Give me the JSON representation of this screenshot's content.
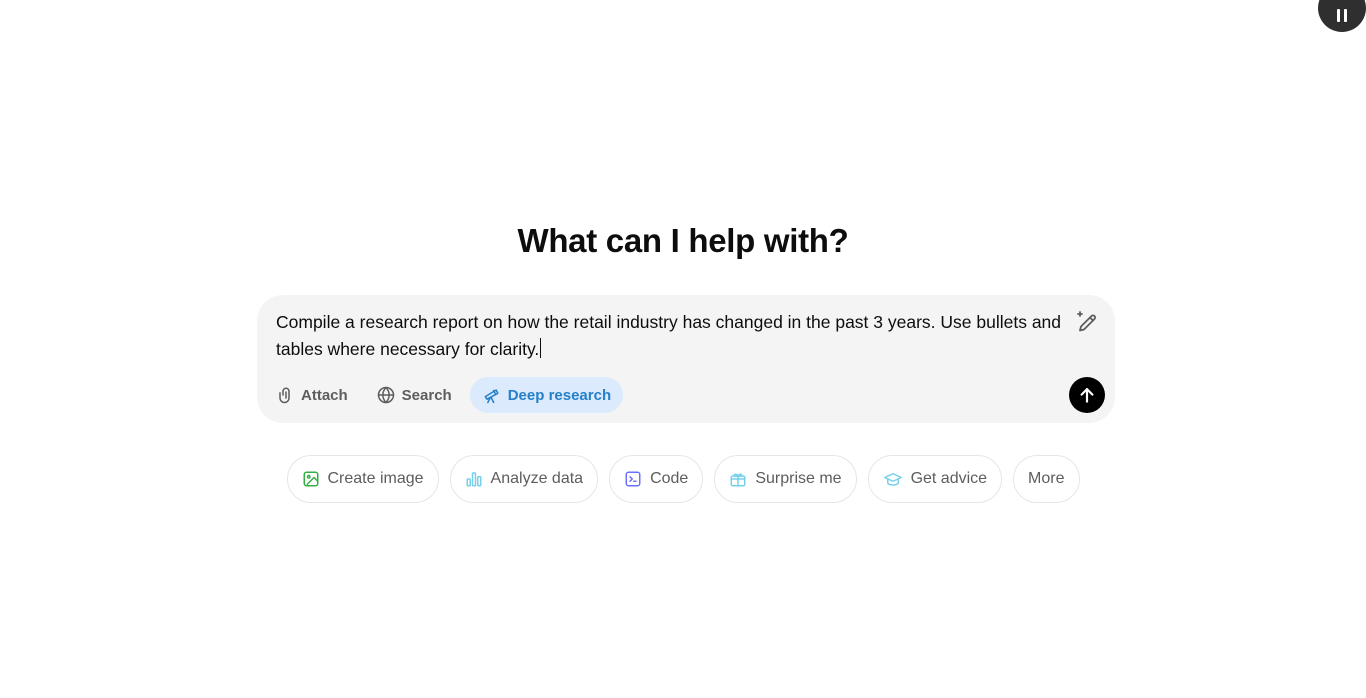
{
  "heading": "What can I help with?",
  "composer": {
    "prompt": "Compile a research report on how the retail industry has changed in the past 3 years. Use bullets and tables where necessary for clarity."
  },
  "tools": [
    {
      "label": "Attach",
      "icon": "paperclip-icon",
      "active": false
    },
    {
      "label": "Search",
      "icon": "globe-icon",
      "active": false
    },
    {
      "label": "Deep research",
      "icon": "telescope-icon",
      "active": true
    }
  ],
  "suggestions": [
    {
      "label": "Create image",
      "icon": "image-icon",
      "color": "#35ae47"
    },
    {
      "label": "Analyze data",
      "icon": "bar-chart-icon",
      "color": "#76d0eb"
    },
    {
      "label": "Code",
      "icon": "terminal-icon",
      "color": "#6c71ff"
    },
    {
      "label": "Surprise me",
      "icon": "gift-icon",
      "color": "#76d0eb"
    },
    {
      "label": "Get advice",
      "icon": "graduation-cap-icon",
      "color": "#76d0eb"
    },
    {
      "label": "More",
      "icon": "",
      "color": ""
    }
  ],
  "colors": {
    "composer_bg": "#f4f4f4",
    "deep_research_bg": "#dbeafc",
    "deep_research_fg": "#2680c9",
    "send_bg": "#000000"
  }
}
